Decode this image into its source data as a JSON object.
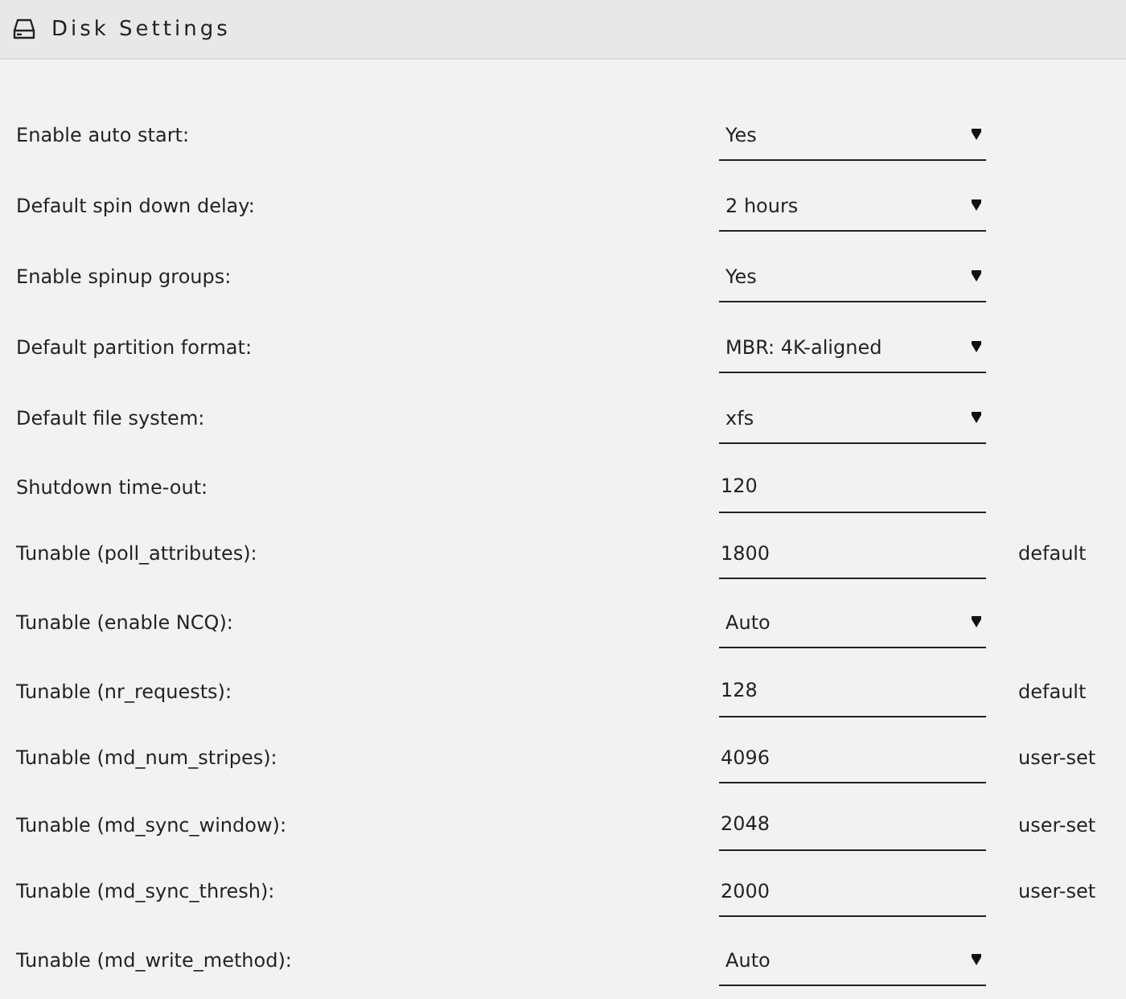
{
  "header": {
    "title": "Disk Settings"
  },
  "settings": [
    {
      "label": "Enable auto start:",
      "kind": "select",
      "value": "Yes"
    },
    {
      "label": "Default spin down delay:",
      "kind": "select",
      "value": "2 hours"
    },
    {
      "label": "Enable spinup groups:",
      "kind": "select",
      "value": "Yes"
    },
    {
      "label": "Default partition format:",
      "kind": "select",
      "value": "MBR: 4K-aligned"
    },
    {
      "label": "Default file system:",
      "kind": "select",
      "value": "xfs"
    },
    {
      "label": "Shutdown time-out:",
      "kind": "input",
      "value": "120"
    },
    {
      "label": "Tunable (poll_attributes):",
      "kind": "input",
      "value": "1800",
      "note": "default"
    },
    {
      "label": "Tunable (enable NCQ):",
      "kind": "select",
      "value": "Auto"
    },
    {
      "label": "Tunable (nr_requests):",
      "kind": "input",
      "value": "128",
      "note": "default"
    },
    {
      "label": "Tunable (md_num_stripes):",
      "kind": "input",
      "value": "4096",
      "note": "user-set"
    },
    {
      "label": "Tunable (md_sync_window):",
      "kind": "input",
      "value": "2048",
      "note": "user-set"
    },
    {
      "label": "Tunable (md_sync_thresh):",
      "kind": "input",
      "value": "2000",
      "note": "user-set"
    },
    {
      "label": "Tunable (md_write_method):",
      "kind": "select",
      "value": "Auto"
    }
  ]
}
